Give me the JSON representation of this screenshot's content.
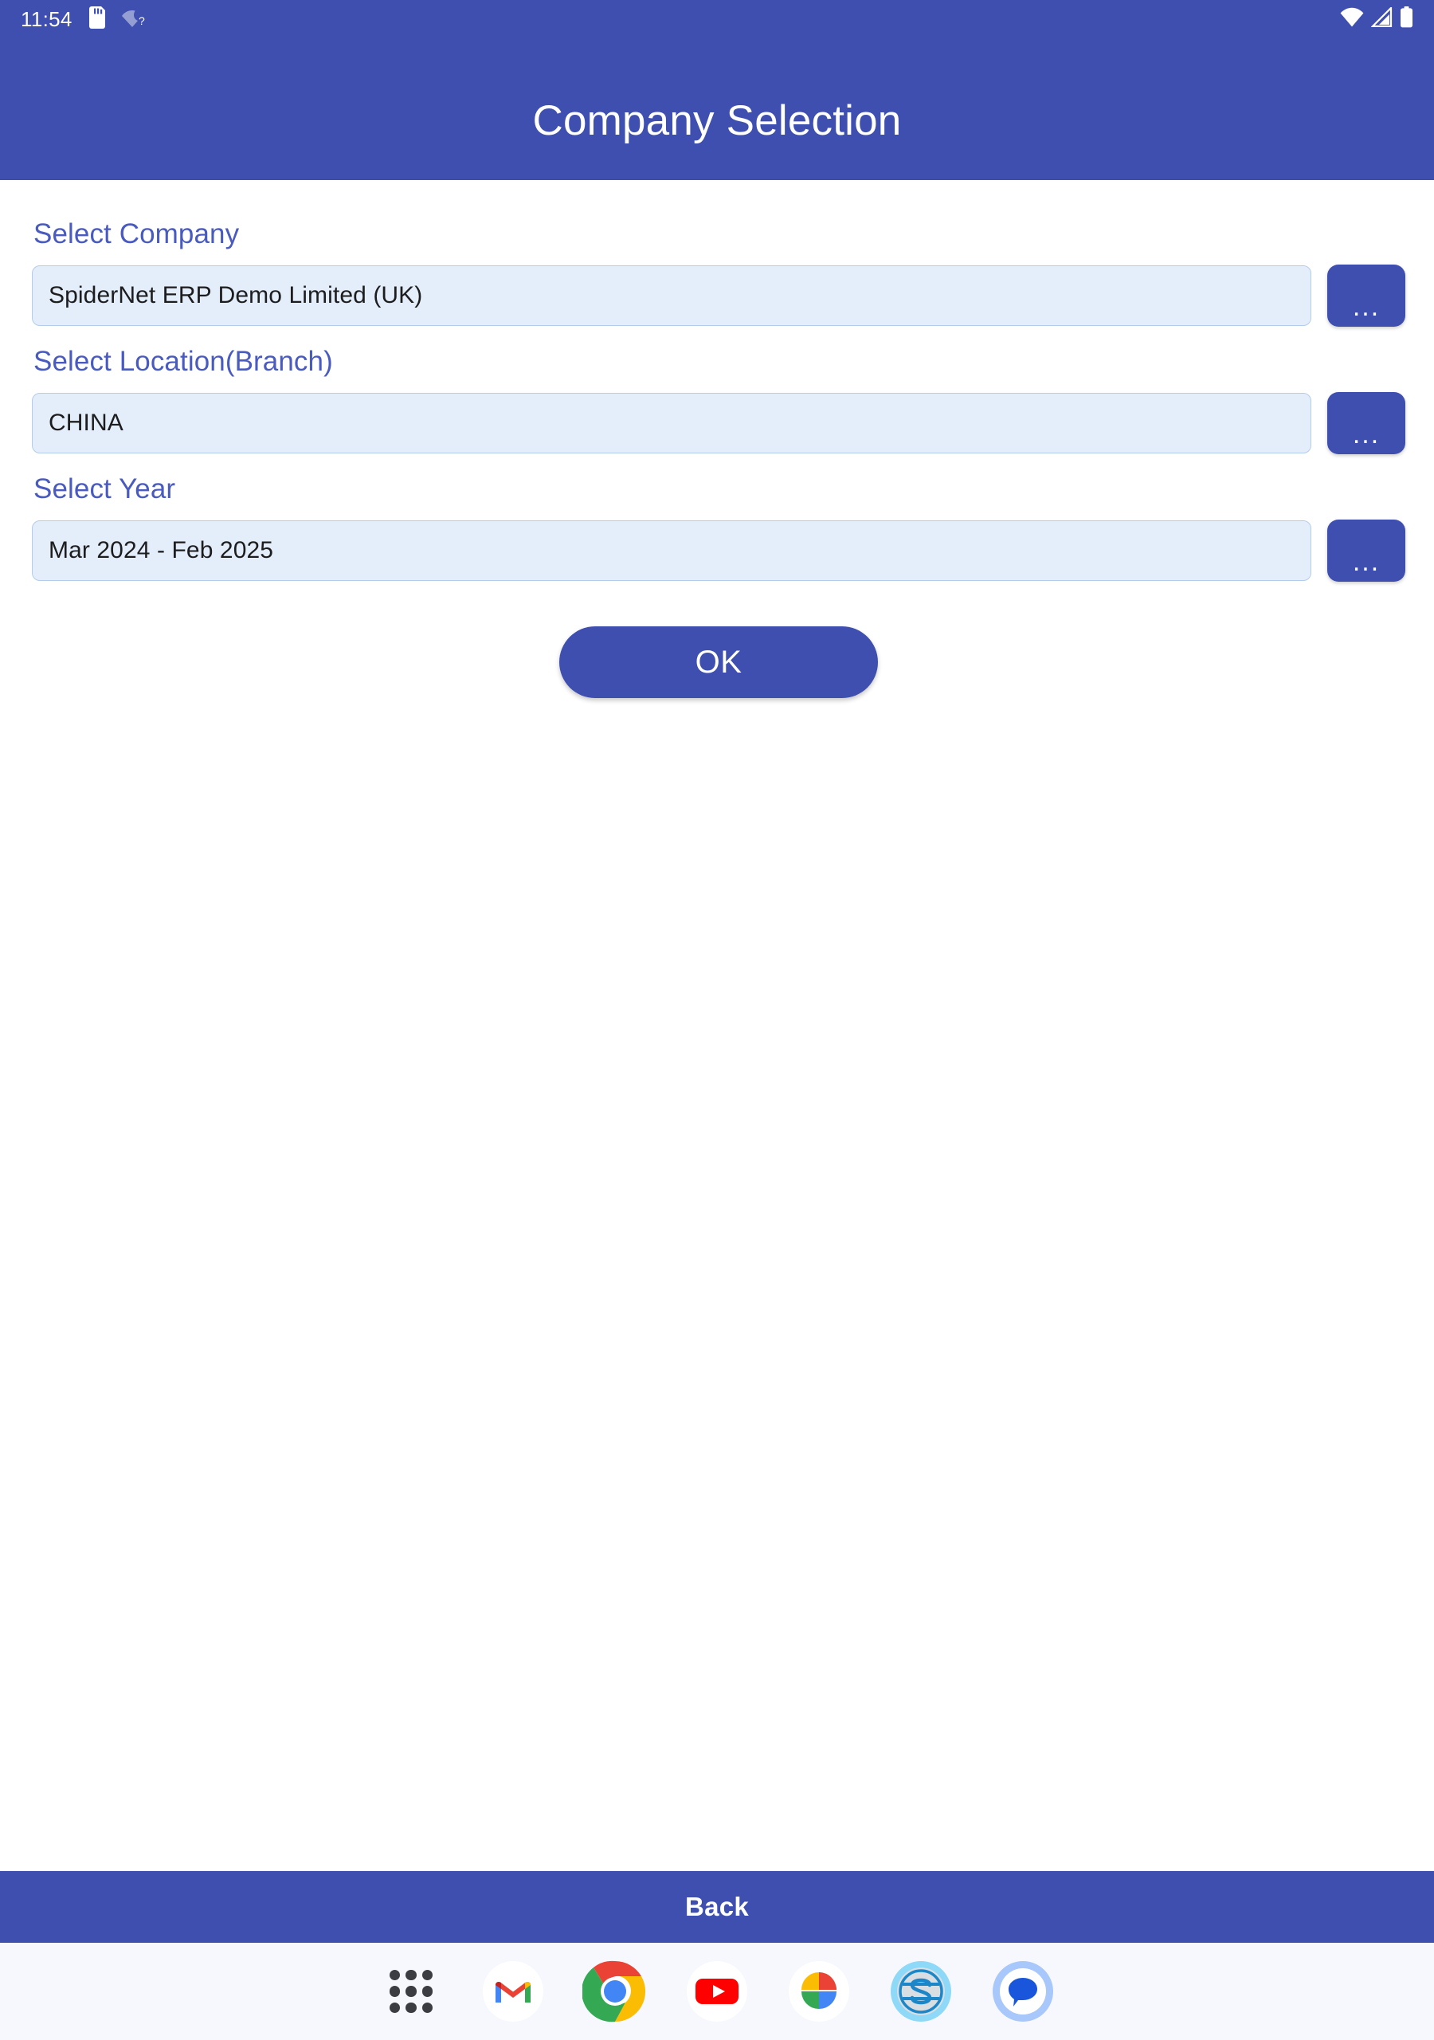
{
  "status_bar": {
    "time": "11:54",
    "left_icons": [
      "sd-card-icon",
      "wifi-question-icon"
    ],
    "right_icons": [
      "wifi-icon",
      "cell-signal-icon",
      "battery-icon"
    ]
  },
  "app_bar": {
    "title": "Company Selection",
    "background_color": "#3E4FB0"
  },
  "form": {
    "fields": [
      {
        "label": "Select Company",
        "value": "SpiderNet ERP Demo Limited (UK)",
        "browse_label": "..."
      },
      {
        "label": "Select Location(Branch)",
        "value": "CHINA",
        "browse_label": "..."
      },
      {
        "label": "Select Year",
        "value": "Mar 2024 - Feb 2025",
        "browse_label": "..."
      }
    ],
    "ok_label": "OK"
  },
  "bottom_bar": {
    "back_label": "Back"
  },
  "dock": {
    "items": [
      {
        "name": "app-drawer-icon"
      },
      {
        "name": "gmail-icon"
      },
      {
        "name": "chrome-icon"
      },
      {
        "name": "youtube-icon"
      },
      {
        "name": "google-photos-icon"
      },
      {
        "name": "spidernet-erp-icon"
      },
      {
        "name": "google-messages-icon"
      }
    ]
  },
  "colors": {
    "primary": "#3E4FB0",
    "label": "#4A5BC0",
    "input_bg": "#E3EEFA",
    "input_border": "#B3CCEC",
    "dock_bg": "#F7F8FD"
  }
}
